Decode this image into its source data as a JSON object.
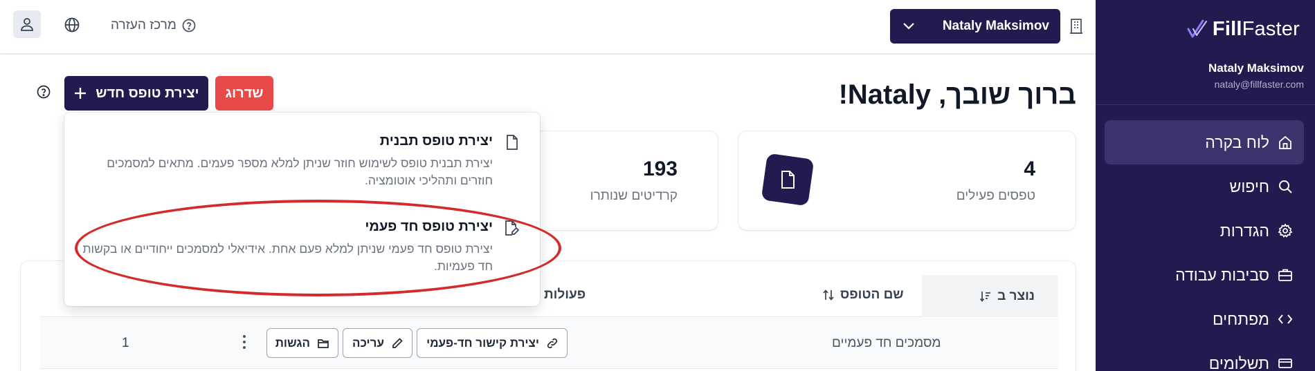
{
  "sidebar": {
    "logo_text_bold": "Fill",
    "logo_text_regular": "Faster",
    "user_name": "Nataly Maksimov",
    "user_email": "nataly@fillfaster.com",
    "items": [
      {
        "label": "לוח בקרה",
        "icon": "home-icon",
        "active": true
      },
      {
        "label": "חיפוש",
        "icon": "search-icon",
        "active": false
      },
      {
        "label": "הגדרות",
        "icon": "gear-icon",
        "active": false
      },
      {
        "label": "סביבות עבודה",
        "icon": "briefcase-icon",
        "active": false
      },
      {
        "label": "מפתחים",
        "icon": "code-icon",
        "active": false
      },
      {
        "label": "תשלומים",
        "icon": "payments-icon",
        "active": false
      }
    ]
  },
  "topbar": {
    "user_dropdown": "Nataly Maksimov",
    "help_label": "מרכז העזרה"
  },
  "main": {
    "greeting": "ברוך שובך, Nataly!",
    "new_form_button": "יצירת טופס חדש",
    "upgrade_button": "שדרוג"
  },
  "cards": [
    {
      "value": "4",
      "label": "טפסים פעילים"
    },
    {
      "value": "193",
      "label": "קרדיטים שנותרו"
    }
  ],
  "dropdown": {
    "items": [
      {
        "title": "יצירת טופס תבנית",
        "description": "יצירת תבנית טופס לשימוש חוזר שניתן למלא מספר פעמים. מתאים למסמכים חוזרים ותהליכי אוטומציה."
      },
      {
        "title": "יצירת טופס חד פעמי",
        "description": "יצירת טופס חד פעמי שניתן למלא פעם אחת. אידיאלי למסמכים ייחודיים או בקשות חד פעמיות."
      }
    ]
  },
  "table": {
    "headers": {
      "created": "נוצר ב",
      "name": "שם הטופס",
      "actions": "פעולות"
    },
    "rows": [
      {
        "name": "מסמכים חד פעמיים",
        "link_button": "יצירת קישור חד-פעמי",
        "edit_button": "עריכה",
        "submissions_button": "הגשות",
        "count": "1"
      }
    ]
  },
  "colors": {
    "brand": "#221b4f",
    "upgrade": "#e84a4a",
    "highlight": "#d42a2a"
  }
}
